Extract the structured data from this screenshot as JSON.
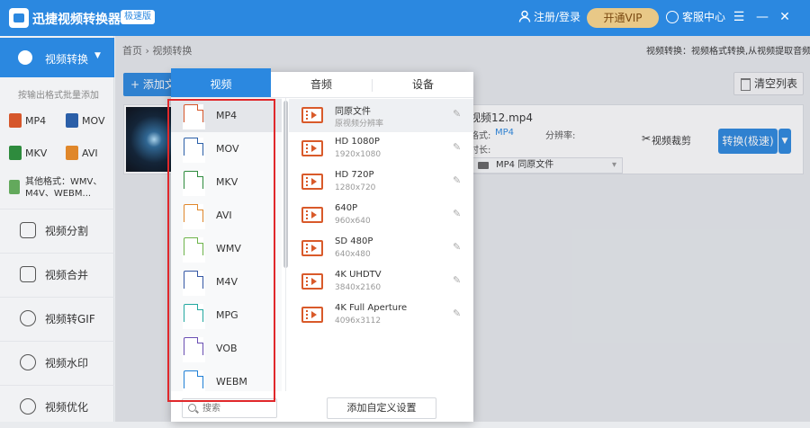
{
  "window": {
    "title": "迅捷视频转换器",
    "badge": "极速版",
    "login": "注册/登录",
    "vip": "开通VIP",
    "service": "客服中心",
    "menu_icon": "☰",
    "min_icon": "—",
    "close_icon": "✕"
  },
  "sidebar": {
    "active": "视频转换",
    "hint": "按输出格式批量添加",
    "quick_formats": [
      "MP4",
      "MOV",
      "MKV",
      "AVI"
    ],
    "other_formats": "其他格式：WMV、M4V、WEBM...",
    "items": [
      "视频分割",
      "视频合并",
      "视频转GIF",
      "视频水印",
      "视频优化"
    ]
  },
  "main": {
    "breadcrumb": "首页 › 视频转换",
    "desc": "视频转换：视频格式转换,从视频提取音频",
    "add_button": "+ 添加文件",
    "clear_button": "清空列表",
    "file": {
      "name": "视频12.mp4",
      "format_label": "格式:",
      "format_value": "MP4",
      "res_label": "分辨率:",
      "duration_label": "时长:",
      "output": "MP4  同原文件",
      "cut": "视频裁剪",
      "convert": "转换(极速)"
    }
  },
  "format_panel": {
    "tabs": [
      "视频",
      "音频",
      "设备"
    ],
    "formats": [
      {
        "name": "MP4",
        "color": "#d6572b"
      },
      {
        "name": "MOV",
        "color": "#2b5fa8"
      },
      {
        "name": "MKV",
        "color": "#2e8b3d"
      },
      {
        "name": "AVI",
        "color": "#e0872a"
      },
      {
        "name": "WMV",
        "color": "#6db44a"
      },
      {
        "name": "M4V",
        "color": "#3457a4"
      },
      {
        "name": "MPG",
        "color": "#23a8a0"
      },
      {
        "name": "VOB",
        "color": "#6a4fb3"
      },
      {
        "name": "WEBM",
        "color": "#1f7fd6"
      }
    ],
    "search_placeholder": "搜索",
    "qualities": [
      {
        "name": "同原文件",
        "sub": "原视频分辨率"
      },
      {
        "name": "HD 1080P",
        "sub": "1920x1080"
      },
      {
        "name": "HD 720P",
        "sub": "1280x720"
      },
      {
        "name": "640P",
        "sub": "960x640"
      },
      {
        "name": "SD 480P",
        "sub": "640x480"
      },
      {
        "name": "4K UHDTV",
        "sub": "3840x2160"
      },
      {
        "name": "4K Full Aperture",
        "sub": "4096x3112"
      }
    ],
    "custom_button": "添加自定义设置"
  }
}
